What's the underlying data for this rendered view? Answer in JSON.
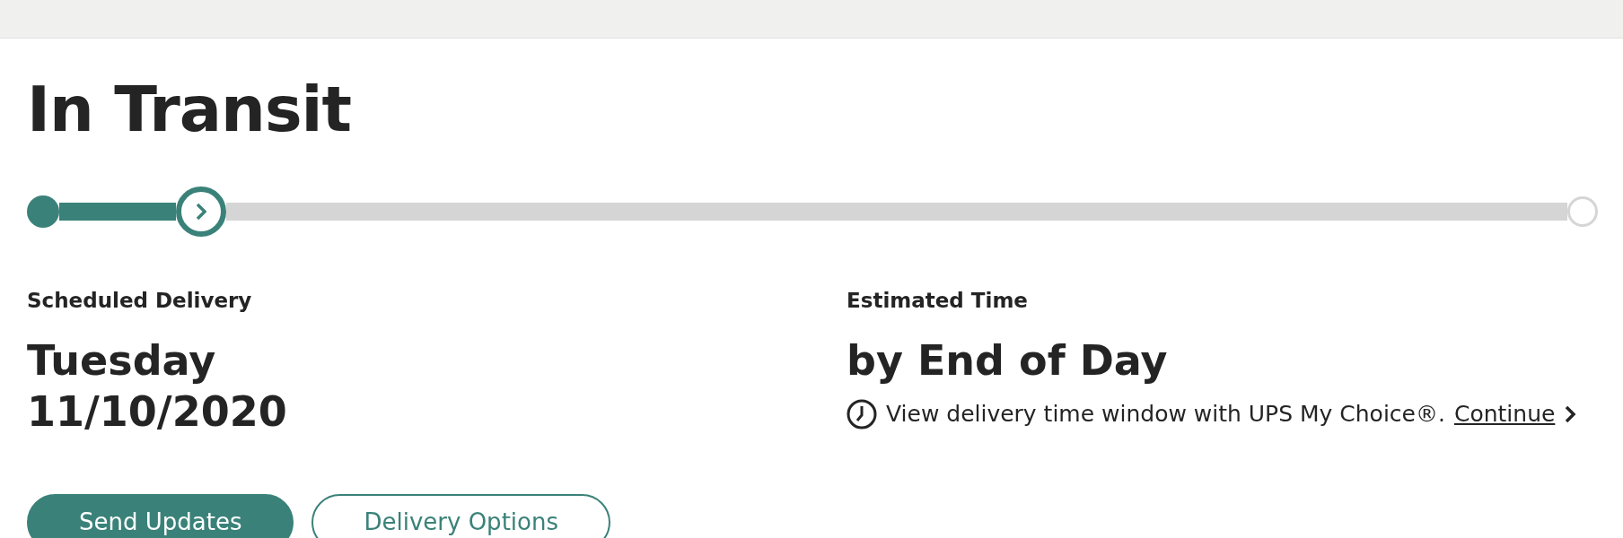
{
  "status": "In Transit",
  "progress": {
    "level": 0.08
  },
  "scheduled": {
    "label": "Scheduled Delivery",
    "day": "Tuesday",
    "date": "11/10/2020"
  },
  "estimated": {
    "label": "Estimated Time",
    "value": "by End of Day",
    "note": "View delivery time window with UPS My Choice®.",
    "link": "Continue"
  },
  "buttons": [
    {
      "label": "Send Updates",
      "kind": "primary"
    },
    {
      "label": "Delivery Options",
      "kind": "outline"
    }
  ]
}
